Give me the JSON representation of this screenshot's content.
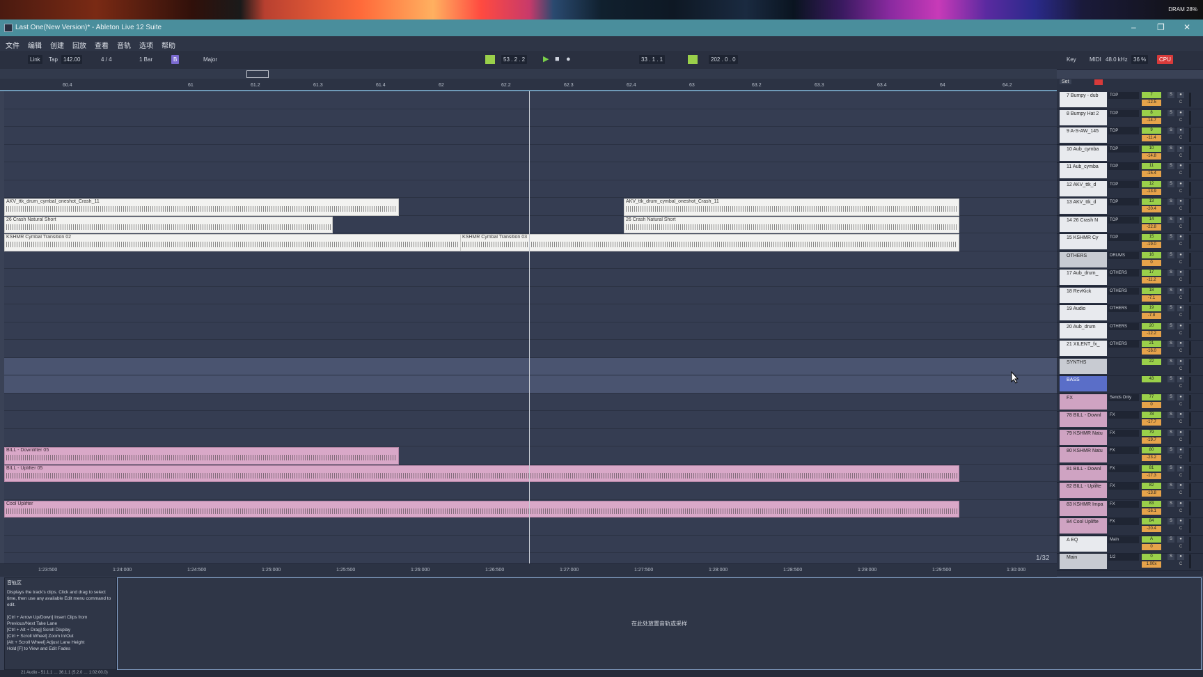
{
  "top_status": "DRAM 28%",
  "window": {
    "title": "Last One(New Version)* - Ableton Live 12 Suite",
    "min": "–",
    "max": "❐",
    "close": "✕"
  },
  "menu": [
    "文件",
    "编辑",
    "创建",
    "回放",
    "查看",
    "音轨",
    "选项",
    "帮助"
  ],
  "transport": {
    "link": "Link",
    "tap": "Tap",
    "tempo": "142.00",
    "signature": "4 / 4",
    "quantize": "1 Bar",
    "key": "B",
    "scale": "Major",
    "position": "53 . 2 . 2",
    "loop_start": "33 . 1 . 1",
    "loop_length": "202 . 0 . 0",
    "key_map": "Key",
    "midi": "MIDI",
    "sample_rate": "48.0 kHz",
    "cpu_pct": "36 %",
    "cpu": "CPU"
  },
  "ruler": [
    "60.4",
    "61",
    "61.2",
    "61.3",
    "61.4",
    "62",
    "62.2",
    "62.3",
    "62.4",
    "63",
    "63.2",
    "63.3",
    "63.4",
    "64",
    "64.2"
  ],
  "bottom_ruler": [
    "1:23:500",
    "1:24:000",
    "1:24:500",
    "1:25:000",
    "1:25:500",
    "1:26:000",
    "1:26:500",
    "1:27:000",
    "1:27:500",
    "1:28:000",
    "1:28:500",
    "1:29:000",
    "1:29:500",
    "1:30:000"
  ],
  "pager": "1/32",
  "set_label": "Set",
  "clips": [
    {
      "lane": 6,
      "from": 0,
      "to": 565,
      "name": "AKV_ttk_drum_cymbal_oneshot_Crash_11",
      "color": "white"
    },
    {
      "lane": 6,
      "from": 890,
      "to": 1370,
      "name": "AKV_ttk_drum_cymbal_oneshot_Crash_11",
      "color": "white"
    },
    {
      "lane": 7,
      "from": 0,
      "to": 470,
      "name": "26 Crash Natural Short",
      "color": "white"
    },
    {
      "lane": 7,
      "from": 890,
      "to": 1370,
      "name": "26 Crash Natural Short",
      "color": "white"
    },
    {
      "lane": 8,
      "from": 0,
      "to": 655,
      "name": "KSHMR Cymbal Transition 02",
      "color": "white"
    },
    {
      "lane": 8,
      "from": 655,
      "to": 1370,
      "name": "KSHMR Cymbal Transition 03",
      "color": "white"
    },
    {
      "lane": 20,
      "from": 0,
      "to": 565,
      "name": "BILL - Downlifter 05",
      "color": "pink"
    },
    {
      "lane": 21,
      "from": 0,
      "to": 1370,
      "name": "BILL - Uplifter 05",
      "color": "pink"
    },
    {
      "lane": 23,
      "from": 0,
      "to": 1370,
      "name": "Cool Uplifter",
      "color": "pink"
    }
  ],
  "tracks": [
    {
      "name": "7 Bumpy - dub",
      "route": "TOP",
      "num": "7",
      "vol": "-12.5",
      "style": "w"
    },
    {
      "name": "8 Bumpy Hat 2",
      "route": "TOP",
      "num": "8",
      "vol": "-14.7",
      "style": "w"
    },
    {
      "name": "9 A-S-AW_145",
      "route": "TOP",
      "num": "9",
      "vol": "-11.4",
      "style": "w"
    },
    {
      "name": "10 Aub_cymba",
      "route": "TOP",
      "num": "10",
      "vol": "-14.8",
      "style": "w"
    },
    {
      "name": "11 Aub_cymba",
      "route": "TOP",
      "num": "11",
      "vol": "-15.4",
      "style": "w"
    },
    {
      "name": "12 AKV_ttk_d",
      "route": "TOP",
      "num": "12",
      "vol": "-13.9",
      "style": "w"
    },
    {
      "name": "13 AKV_ttk_d",
      "route": "TOP",
      "num": "13",
      "vol": "-20.4",
      "style": "w"
    },
    {
      "name": "14 26 Crash N",
      "route": "TOP",
      "num": "14",
      "vol": "-22.8",
      "style": "w"
    },
    {
      "name": "15 KSHMR Cy",
      "route": "TOP",
      "num": "15",
      "vol": "-19.0",
      "style": "w"
    },
    {
      "name": "OTHERS",
      "route": "DRUMS",
      "num": "16",
      "vol": "0",
      "style": "g"
    },
    {
      "name": "17 Aub_drum_",
      "route": "OTHERS",
      "num": "17",
      "vol": "-11.2",
      "style": "w"
    },
    {
      "name": "18 RevKick",
      "route": "OTHERS",
      "num": "18",
      "vol": "-7.1",
      "style": "w"
    },
    {
      "name": "19 Audio",
      "route": "OTHERS",
      "num": "19",
      "vol": "-7.8",
      "style": "w"
    },
    {
      "name": "20 Aub_drum",
      "route": "OTHERS",
      "num": "20",
      "vol": "-12.2",
      "style": "w"
    },
    {
      "name": "21 XILENT_fx_",
      "route": "OTHERS",
      "num": "21",
      "vol": "-16.0",
      "style": "w"
    },
    {
      "name": "SYNTHS",
      "route": "",
      "num": "22",
      "vol": "",
      "style": "g"
    },
    {
      "name": "BASS",
      "route": "",
      "num": "43",
      "vol": "",
      "style": "sel"
    },
    {
      "name": "FX",
      "route": "Sends Only",
      "num": "77",
      "vol": "0",
      "style": "p"
    },
    {
      "name": "78 BILL - Downl",
      "route": "FX",
      "num": "78",
      "vol": "-17.7",
      "style": "p"
    },
    {
      "name": "79 KSHMR Natu",
      "route": "FX",
      "num": "79",
      "vol": "-19.7",
      "style": "p"
    },
    {
      "name": "80 KSHMR Natu",
      "route": "FX",
      "num": "80",
      "vol": "-23.2",
      "style": "p"
    },
    {
      "name": "81 BILL - Downl",
      "route": "FX",
      "num": "81",
      "vol": "-17.3",
      "style": "p"
    },
    {
      "name": "82 BILL - Uplifte",
      "route": "FX",
      "num": "82",
      "vol": "-13.8",
      "style": "p"
    },
    {
      "name": "83 KSHMR Impa",
      "route": "FX",
      "num": "83",
      "vol": "-16.1",
      "style": "p"
    },
    {
      "name": "84 Cool Uplifte",
      "route": "FX",
      "num": "84",
      "vol": "-20.4",
      "style": "p"
    },
    {
      "name": "A EQ",
      "route": "Main",
      "num": "A",
      "vol": "0",
      "style": "w"
    },
    {
      "name": "Main",
      "route": "1/2",
      "num": "0",
      "vol": "1.00x",
      "style": "g"
    }
  ],
  "info": {
    "heading": "音轨区",
    "body": "Displays the track's clips. Click and drag to select time, then use any available Edit menu command to edit.\n\n[Ctrl + Arrow Up/Down] Insert Clips from Previous/Next Take Lane\n[Ctrl + Alt + Drag] Scroll Display\n[Ctrl + Scroll Wheel] Zoom In/Out\n[Alt + Scroll Wheel] Adjust Lane Height\nHold [F] to View and Edit Fades"
  },
  "detail_message": "在此处放置音轨或采样",
  "status_text": "21 Audio  -  51.1.1  …  36.1.1  (5.2.0 … 1:02:00.0)"
}
